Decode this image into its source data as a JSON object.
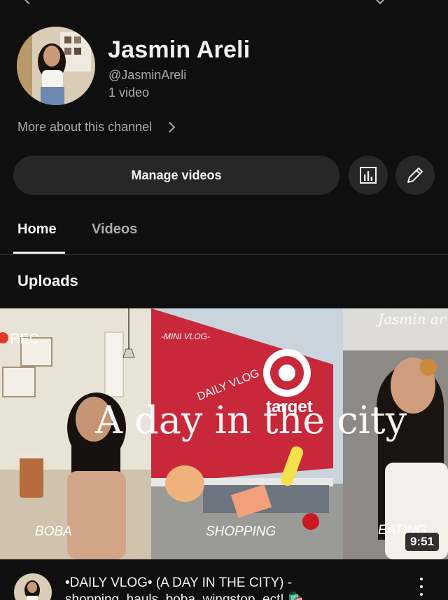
{
  "channel": {
    "name": "Jasmin Areli",
    "handle": "@JasminAreli",
    "video_count": "1 video",
    "more_about": "More about this channel"
  },
  "actions": {
    "manage_label": "Manage videos",
    "analytics_icon": "analytics-icon",
    "edit_icon": "pencil-icon"
  },
  "tabs": [
    {
      "label": "Home",
      "selected": true
    },
    {
      "label": "Videos",
      "selected": false
    }
  ],
  "section": {
    "title": "Uploads"
  },
  "video": {
    "thumbnail": {
      "rec": "REC",
      "mini_vlog": "-MINI VLOG-",
      "daily_vlog": "DAILY VLOG",
      "headline": "A day in the city",
      "watermark": "Jasmin ar",
      "store": "target",
      "captions": [
        "BOBA",
        "SHOPPING",
        "EATING"
      ]
    },
    "duration": "9:51",
    "title_line1": "•DAILY VLOG•  (A DAY IN THE CITY) -",
    "title_line2": "shopping, hauls, boba, wingstop, ect! 🛍️"
  },
  "colors": {
    "background": "#0f0f0f",
    "surface": "#272727",
    "text_primary": "#f1f1f1",
    "text_secondary": "#aaaaaa",
    "target_red": "#c8283a"
  }
}
